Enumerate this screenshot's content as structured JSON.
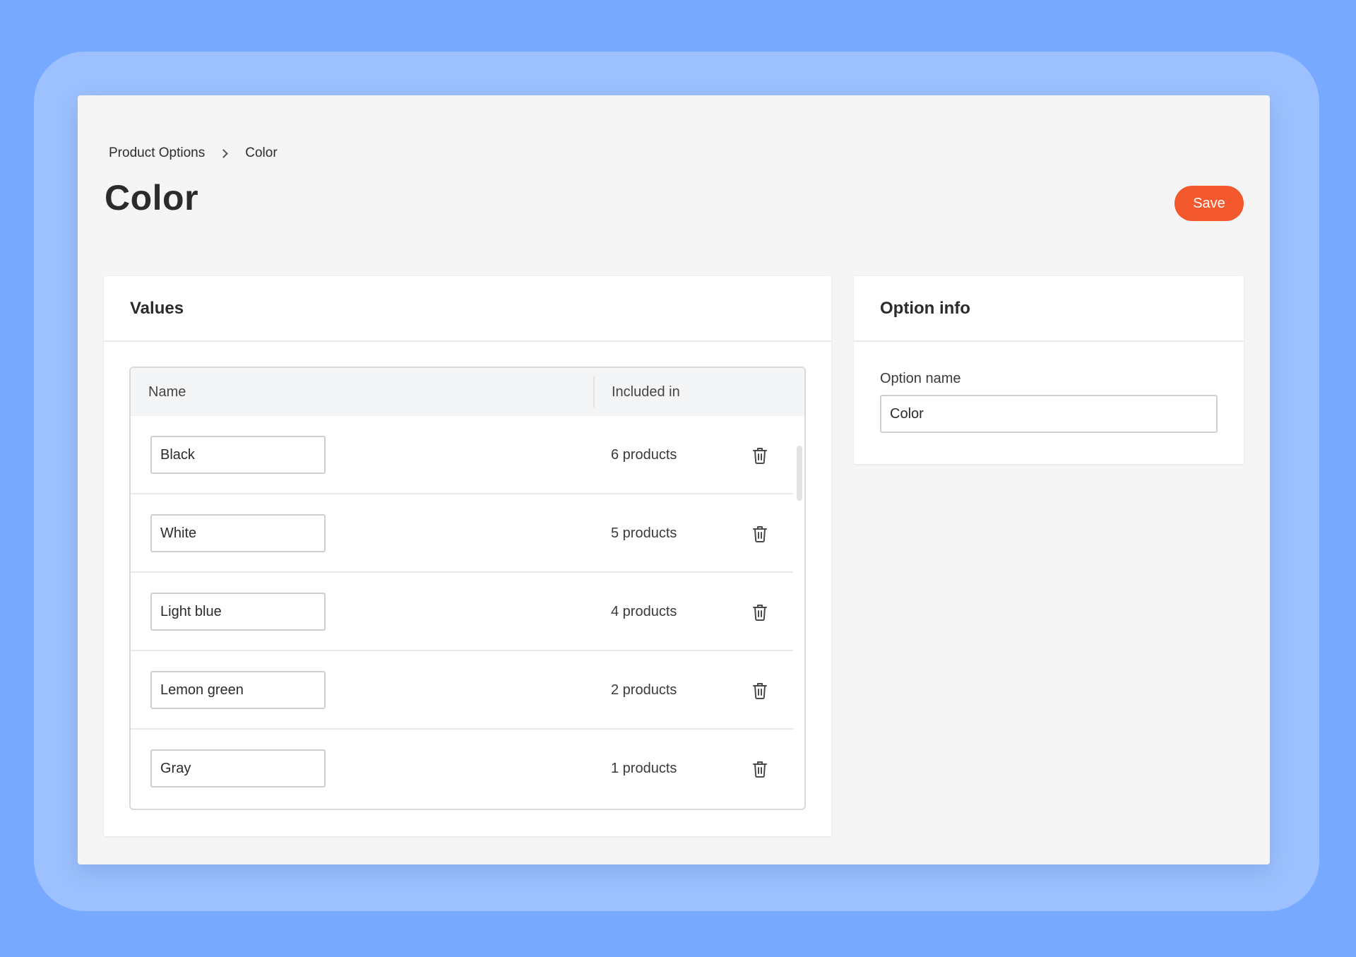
{
  "breadcrumb": {
    "parent": "Product Options",
    "current": "Color"
  },
  "page": {
    "title": "Color",
    "save_label": "Save"
  },
  "values_card": {
    "title": "Values",
    "columns": {
      "name": "Name",
      "included": "Included in"
    },
    "rows": [
      {
        "name": "Black",
        "count": "6 products"
      },
      {
        "name": "White",
        "count": "5 products"
      },
      {
        "name": "Light blue",
        "count": "4 products"
      },
      {
        "name": "Lemon green",
        "count": "2 products"
      },
      {
        "name": "Gray",
        "count": "1 products"
      }
    ]
  },
  "info_card": {
    "title": "Option info",
    "field_label": "Option name",
    "field_value": "Color"
  },
  "icons": {
    "breadcrumb_separator": "chevron-right-icon",
    "row_action": "trash-icon"
  },
  "colors": {
    "accent": "#f4582d",
    "background": "#76a9ff",
    "frame": "#9dc1fe",
    "surface": "#f4f5f4"
  }
}
